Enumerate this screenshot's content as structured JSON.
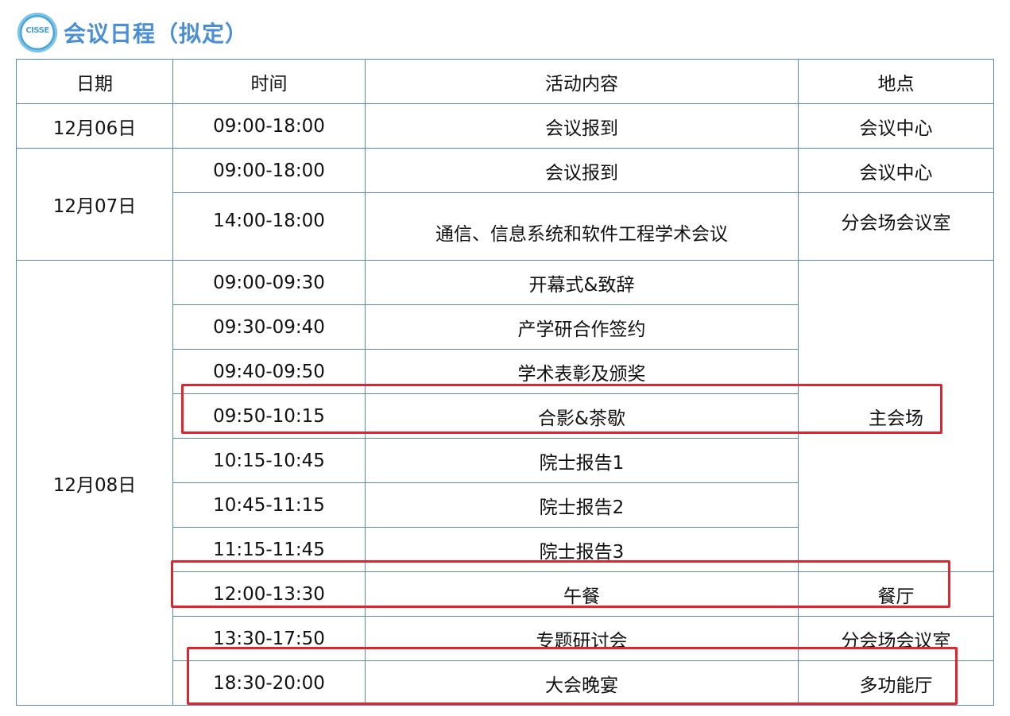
{
  "header": {
    "logo_text": "CISSE",
    "title": "会议日程（拟定）"
  },
  "colors": {
    "title": "#4a8fd6",
    "border": "#5b88b2",
    "highlight": "#e0252f"
  },
  "table": {
    "columns": [
      "日期",
      "时间",
      "活动内容",
      "地点"
    ],
    "dates": {
      "d1": "12月06日",
      "d2": "12月07日",
      "d3": "12月08日"
    },
    "rows": [
      {
        "time": "09:00-18:00",
        "activity": "会议报到",
        "place": "会议中心"
      },
      {
        "time": "09:00-18:00",
        "activity": "会议报到",
        "place": "会议中心"
      },
      {
        "time": "14:00-18:00",
        "activity": "通信、信息系统和软件工程学术会议",
        "place": "分会场会议室"
      },
      {
        "time": "09:00-09:30",
        "activity": "开幕式&致辞"
      },
      {
        "time": "09:30-09:40",
        "activity": "产学研合作签约"
      },
      {
        "time": "09:40-09:50",
        "activity": "学术表彰及颁奖"
      },
      {
        "time": "09:50-10:15",
        "activity": "合影&茶歇"
      },
      {
        "time": "10:15-10:45",
        "activity": "院士报告1"
      },
      {
        "time": "10:45-11:15",
        "activity": "院士报告2"
      },
      {
        "time": "11:15-11:45",
        "activity": "院士报告3"
      },
      {
        "time": "12:00-13:30",
        "activity": "午餐",
        "place": "餐厅"
      },
      {
        "time": "13:30-17:50",
        "activity": "专题研讨会",
        "place": "分会场会议室"
      },
      {
        "time": "18:30-20:00",
        "activity": "大会晚宴",
        "place": "多功能厅"
      }
    ],
    "main_venue": "主会场"
  }
}
